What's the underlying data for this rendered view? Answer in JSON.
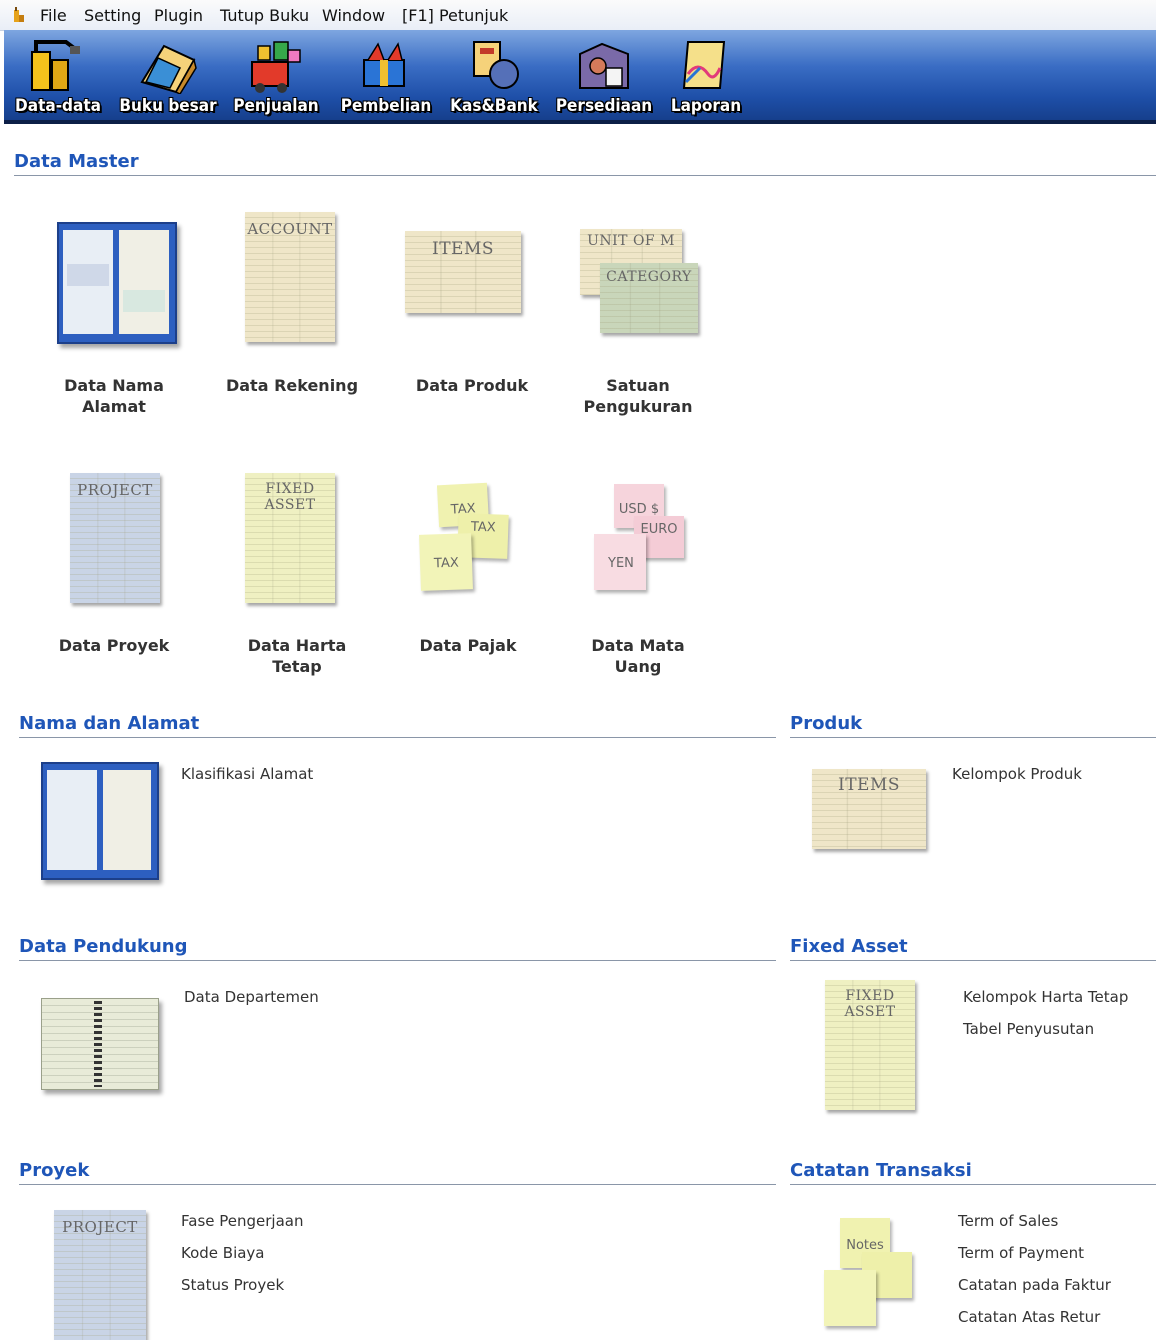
{
  "menu": [
    "File",
    "Setting",
    "Plugin",
    "Tutup Buku",
    "Window",
    "[F1] Petunjuk"
  ],
  "toolbar": [
    {
      "label": "Data-data",
      "icon": "data-data-icon"
    },
    {
      "label": "Buku besar",
      "icon": "ledger-icon"
    },
    {
      "label": "Penjualan",
      "icon": "sales-icon"
    },
    {
      "label": "Pembelian",
      "icon": "purchase-icon"
    },
    {
      "label": "Kas&Bank",
      "icon": "cash-bank-icon"
    },
    {
      "label": "Persediaan",
      "icon": "inventory-icon"
    },
    {
      "label": "Laporan",
      "icon": "report-icon"
    }
  ],
  "data_master": {
    "title": "Data Master",
    "items": [
      {
        "label": "Data Nama Alamat"
      },
      {
        "label": "Data Rekening",
        "icon_text": "ACCOUNT"
      },
      {
        "label": "Data Produk",
        "icon_text": "ITEMS"
      },
      {
        "label": "Satuan Pengukuran",
        "icon_text": "UNIT OF M",
        "icon_text2": "CATEGORY"
      },
      {
        "label": "Data Proyek",
        "icon_text": "PROJECT"
      },
      {
        "label": "Data Harta Tetap",
        "icon_text": "FIXED ASSET"
      },
      {
        "label": "Data Pajak",
        "icon_text": "TAX",
        "icon_text2": "TAX",
        "icon_text3": "TAX"
      },
      {
        "label": "Data Mata Uang",
        "icon_text": "USD $",
        "icon_text2": "EURO",
        "icon_text3": "YEN"
      }
    ]
  },
  "nama_alamat": {
    "title": "Nama dan Alamat",
    "links": [
      "Klasifikasi Alamat"
    ]
  },
  "produk": {
    "title": "Produk",
    "icon_text": "ITEMS",
    "links": [
      "Kelompok Produk"
    ]
  },
  "data_pendukung": {
    "title": "Data Pendukung",
    "links": [
      "Data Departemen"
    ]
  },
  "fixed_asset": {
    "title": "Fixed Asset",
    "icon_text": "FIXED ASSET",
    "links": [
      "Kelompok Harta Tetap",
      "Tabel Penyusutan"
    ]
  },
  "proyek": {
    "title": "Proyek",
    "icon_text": "PROJECT",
    "links": [
      "Fase Pengerjaan",
      "Kode Biaya",
      "Status Proyek"
    ]
  },
  "catatan": {
    "title": "Catatan Transaksi",
    "icon_text": "Notes",
    "links": [
      "Term of Sales",
      "Term of Payment",
      "Catatan pada Faktur",
      "Catatan Atas Retur"
    ]
  },
  "colors": {
    "accent": "#1f56b8",
    "toolbar": "#2a5cb8"
  }
}
